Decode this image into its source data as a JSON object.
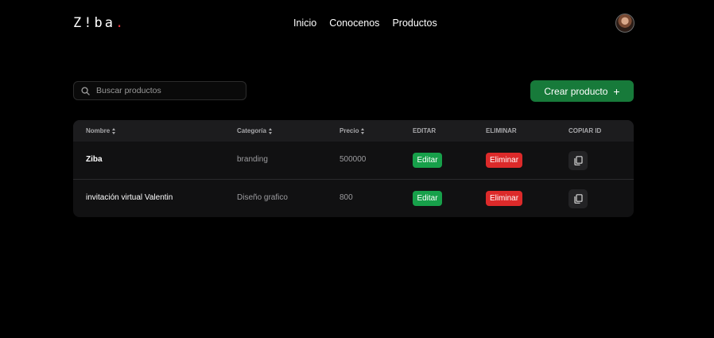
{
  "header": {
    "logo": "Z!ba",
    "logo_dot": ".",
    "nav": [
      {
        "label": "Inicio"
      },
      {
        "label": "Conocenos"
      },
      {
        "label": "Productos"
      }
    ]
  },
  "search": {
    "placeholder": "Buscar productos",
    "value": ""
  },
  "create_button": {
    "label": "Crear producto",
    "icon": "+"
  },
  "table": {
    "columns": [
      {
        "label": "Nombre",
        "sortable": true
      },
      {
        "label": "Categoría",
        "sortable": true
      },
      {
        "label": "Precio",
        "sortable": true
      },
      {
        "label": "EDITAR",
        "sortable": false
      },
      {
        "label": "ELIMINAR",
        "sortable": false
      },
      {
        "label": "COPIAR ID",
        "sortable": false
      }
    ],
    "rows": [
      {
        "name": "Ziba",
        "category": "branding",
        "price": "500000",
        "edit": "Editar",
        "delete": "Eliminar"
      },
      {
        "name": "invitación virtual Valentin",
        "category": "Diseño grafico",
        "price": "800",
        "edit": "Editar",
        "delete": "Eliminar"
      }
    ]
  },
  "colors": {
    "background": "#000000",
    "create_button": "#177a3a",
    "edit_button": "#17a04a",
    "delete_button": "#dc2a2a",
    "logo_accent": "#e0303a"
  },
  "icons": {
    "search": "search-icon",
    "copy": "copy-icon",
    "sort": "sort-icon",
    "avatar": "avatar"
  }
}
